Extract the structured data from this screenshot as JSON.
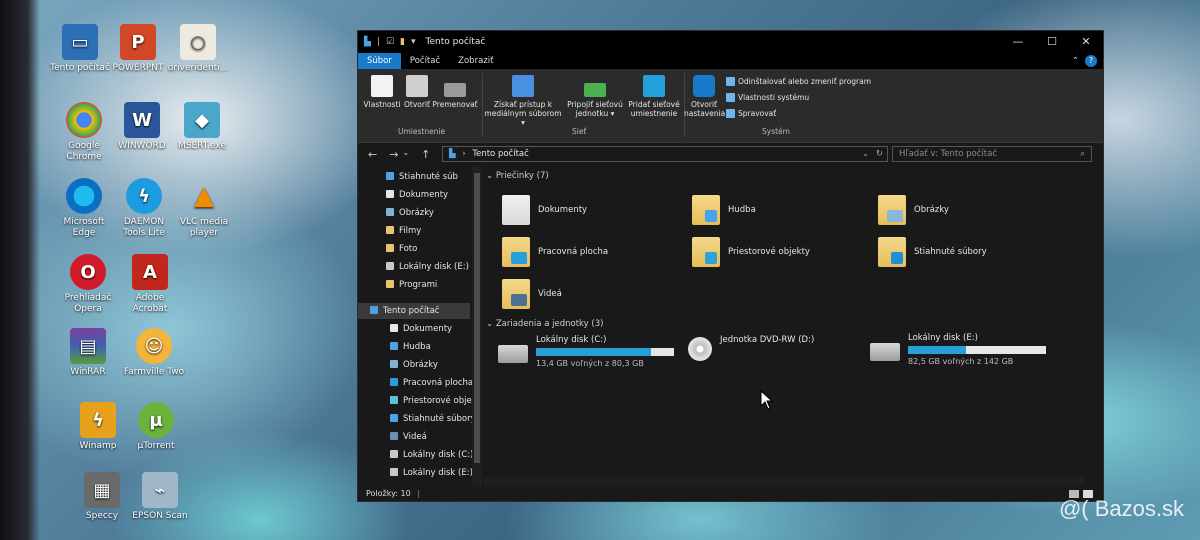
{
  "colors": {
    "accent": "#1979ca",
    "drive_fill": "#26a0da",
    "window_bg": "#191919",
    "titlebar_bg": "#000000",
    "ribbon_bg": "#2b2b2b"
  },
  "desktop": {
    "icons": [
      {
        "label": "Tento počítač",
        "icon": "computer-icon"
      },
      {
        "label": "POWERPNT",
        "icon": "powerpoint-icon"
      },
      {
        "label": "driveridenti...",
        "icon": "file-icon"
      },
      {
        "label": "Google Chrome",
        "icon": "chrome-icon"
      },
      {
        "label": "WINWORD",
        "icon": "word-icon"
      },
      {
        "label": "MSERT.exe",
        "icon": "msert-icon"
      },
      {
        "label": "Microsoft Edge",
        "icon": "edge-icon"
      },
      {
        "label": "DAEMON Tools Lite",
        "icon": "daemon-tools-icon"
      },
      {
        "label": "VLC media player",
        "icon": "vlc-icon"
      },
      {
        "label": "Prehliadač Opera",
        "icon": "opera-icon"
      },
      {
        "label": "Adobe Acrobat",
        "icon": "acrobat-icon"
      },
      {
        "label": "WinRAR",
        "icon": "winrar-icon"
      },
      {
        "label": "Farmville Two",
        "icon": "farmville-icon"
      },
      {
        "label": "Winamp",
        "icon": "winamp-icon"
      },
      {
        "label": "µTorrent",
        "icon": "utorrent-icon"
      },
      {
        "label": "Speccy",
        "icon": "speccy-icon"
      },
      {
        "label": "EPSON Scan",
        "icon": "epson-scan-icon"
      }
    ]
  },
  "window": {
    "title": "Tento počítač",
    "controls": {
      "minimize": "—",
      "maximize": "☐",
      "close": "✕"
    },
    "menu": {
      "file": "Súbor",
      "computer": "Počítač",
      "view": "Zobraziť",
      "collapse": "⌃",
      "help": "?"
    },
    "ribbon": {
      "location_group": "Umiestnenie",
      "network_group": "Sieť",
      "system_group": "Systém",
      "properties": "Vlastnosti",
      "open": "Otvoriť",
      "rename": "Premenovať",
      "media_line1": "Získať prístup k",
      "media_line2": "mediálnym súborom ▾",
      "map_line1": "Pripojiť sieťovú",
      "map_line2": "jednotku ▾",
      "add_line1": "Pridať sieťové",
      "add_line2": "umiestnenie",
      "settings_line1": "Otvoriť",
      "settings_line2": "nastavenia",
      "uninstall": "Odinštalovať alebo zmeniť program",
      "sys_props": "Vlastnosti systému",
      "manage": "Spravovať"
    },
    "address": {
      "path": "Tento počítač",
      "search_placeholder": "Hľadať v: Tento počítač",
      "back": "←",
      "forward": "→",
      "recent": "⌄",
      "up": "↑"
    },
    "sidebar": {
      "items": [
        {
          "label": "Stiahnuté súb"
        },
        {
          "label": "Dokumenty"
        },
        {
          "label": "Obrázky"
        },
        {
          "label": "Filmy"
        },
        {
          "label": "Foto"
        },
        {
          "label": "Lokálny disk (E:)"
        },
        {
          "label": "Programi"
        },
        {
          "label": "Tento počítač"
        },
        {
          "label": "Dokumenty"
        },
        {
          "label": "Hudba"
        },
        {
          "label": "Obrázky"
        },
        {
          "label": "Pracovná plocha"
        },
        {
          "label": "Priestorové obje"
        },
        {
          "label": "Stiahnuté súbory"
        },
        {
          "label": "Videá"
        },
        {
          "label": "Lokálny disk (C:)"
        },
        {
          "label": "Lokálny disk (E:)"
        }
      ]
    },
    "content": {
      "folders_header": "Priečinky (7)",
      "folders": [
        {
          "label": "Dokumenty"
        },
        {
          "label": "Hudba"
        },
        {
          "label": "Obrázky"
        },
        {
          "label": "Pracovná plocha"
        },
        {
          "label": "Priestorové objekty"
        },
        {
          "label": "Stiahnuté súbory"
        },
        {
          "label": "Videá"
        }
      ],
      "devices_header": "Zariadenia a jednotky (3)",
      "drives": [
        {
          "name": "Lokálny disk (C:)",
          "free": "13,4 GB voľných z 80,3 GB",
          "used_fraction": 0.83
        },
        {
          "name": "Jednotka DVD-RW (D:)",
          "free": "",
          "used_fraction": null
        },
        {
          "name": "Lokálny disk (E:)",
          "free": "82,5 GB voľných z 142 GB",
          "used_fraction": 0.42
        }
      ]
    },
    "status": {
      "items": "Položky: 10"
    }
  },
  "watermark": "@( Bazos.sk"
}
